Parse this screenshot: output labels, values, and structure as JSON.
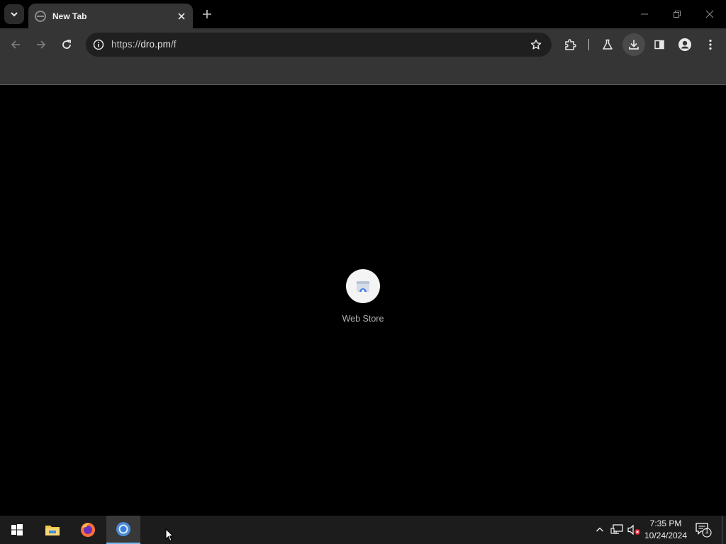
{
  "browser": {
    "tab": {
      "title": "New Tab",
      "favicon": "globe-icon"
    },
    "address": {
      "scheme": "https://",
      "host": "dro.pm",
      "path": "/f"
    },
    "toolbar_icons": [
      "back-icon",
      "forward-icon",
      "reload-icon",
      "info-icon",
      "star-icon",
      "extensions-icon",
      "labs-icon",
      "download-icon",
      "side-panel-icon",
      "profile-icon",
      "menu-icon"
    ]
  },
  "content": {
    "shortcut": {
      "label": "Web Store",
      "icon": "web-store-icon"
    }
  },
  "taskbar": {
    "apps": [
      "start-icon",
      "file-explorer-icon",
      "firefox-icon",
      "chrome-icon"
    ],
    "clock": {
      "time": "7:35 PM",
      "date": "10/24/2024"
    },
    "notification_count": "1"
  },
  "colors": {
    "tab_active": "#353535",
    "toolbar": "#353535",
    "omnibox": "#1f1f1f",
    "page": "#000000",
    "taskbar": "#1c1c1c",
    "accent": "#76b9ed"
  }
}
